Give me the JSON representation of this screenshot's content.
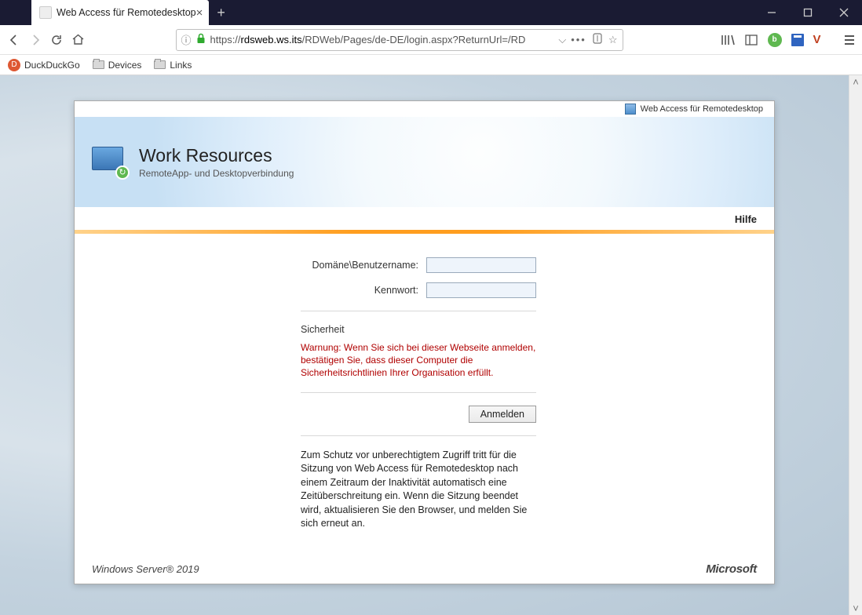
{
  "window": {
    "tab_title": "Web Access für Remotedesktop"
  },
  "toolbar": {
    "url_prefix": "https://",
    "url_host": "rdsweb.ws.its",
    "url_path": "/RDWeb/Pages/de-DE/login.aspx?ReturnUrl=/RD"
  },
  "bookmarks": {
    "duckduckgo": "DuckDuckGo",
    "devices": "Devices",
    "links": "Links"
  },
  "rdweb": {
    "top_label": "Web Access für Remotedesktop",
    "title": "Work Resources",
    "subtitle": "RemoteApp- und Desktopverbindung",
    "help": "Hilfe",
    "form": {
      "username_label": "Domäne\\Benutzername:",
      "password_label": "Kennwort:"
    },
    "security_heading": "Sicherheit",
    "warning": "Warnung: Wenn Sie sich bei dieser Webseite anmelden, bestätigen Sie, dass dieser Computer die Sicherheitsrichtlinien Ihrer Organisation erfüllt.",
    "login_button": "Anmelden",
    "timeout_note": "Zum Schutz vor unberechtigtem Zugriff tritt für die Sitzung von Web Access für Remotedesktop nach einem Zeitraum der Inaktivität automatisch eine Zeitüberschreitung ein. Wenn die Sitzung beendet wird, aktualisieren Sie den Browser, und melden Sie sich erneut an.",
    "footer_server": "Windows Server® 2019",
    "footer_ms": "Microsoft"
  }
}
